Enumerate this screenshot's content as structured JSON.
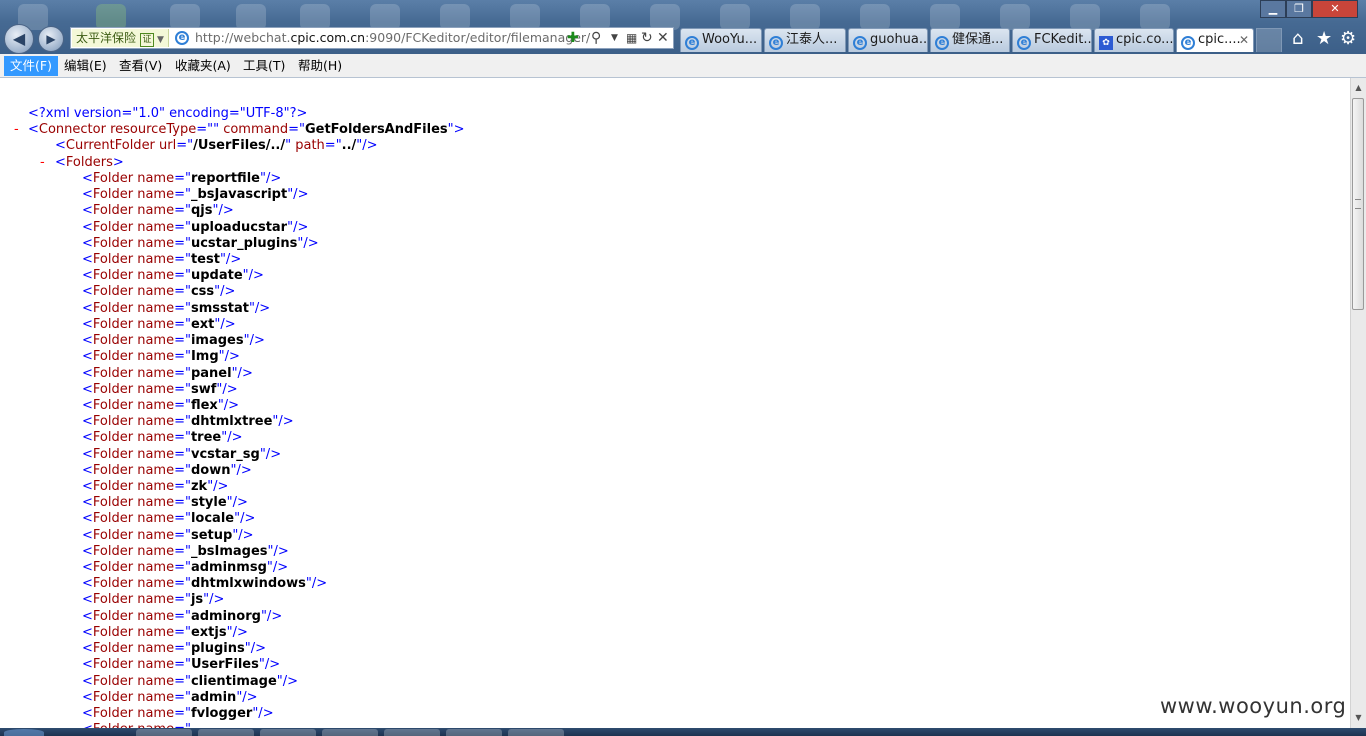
{
  "browser": {
    "site_badge": "太平洋保险",
    "site_badge_icon": "证",
    "address_host_prefix": "http://webchat.",
    "address_host_domain": "cpic.com.cn",
    "address_rest": ":9090/FCKeditor/editor/filemanager/",
    "tabs": [
      {
        "label": "WooYu...",
        "icon": "ie-icon",
        "active": false
      },
      {
        "label": "江泰人...",
        "icon": "ie-icon",
        "active": false
      },
      {
        "label": "guohua...",
        "icon": "ie-icon",
        "active": false
      },
      {
        "label": "健保通...",
        "icon": "ie-icon",
        "active": false
      },
      {
        "label": "FCKedit...",
        "icon": "ie-icon",
        "active": false
      },
      {
        "label": "cpic.co...",
        "icon": "baidu-icon",
        "active": false
      },
      {
        "label": "cpic....",
        "icon": "ie-icon",
        "active": true
      }
    ]
  },
  "menu": {
    "items": [
      "文件(F)",
      "编辑(E)",
      "查看(V)",
      "收藏夹(A)",
      "工具(T)",
      "帮助(H)"
    ]
  },
  "xml": {
    "declaration": "<?xml version=\"1.0\" encoding=\"UTF-8\"?>",
    "connector_resource_type": "",
    "connector_command": "GetFoldersAndFiles",
    "current_folder_url": "/UserFiles/../",
    "current_folder_path": "../",
    "folders": [
      "reportfile",
      "_bsJavascript",
      "qjs",
      "uploaducstar",
      "ucstar_plugins",
      "test",
      "update",
      "css",
      "smsstat",
      "ext",
      "images",
      "Img",
      "panel",
      "swf",
      "flex",
      "dhtmlxtree",
      "tree",
      "vcstar_sg",
      "down",
      "zk",
      "style",
      "locale",
      "setup",
      "_bsImages",
      "adminmsg",
      "dhtmlxwindows",
      "js",
      "adminorg",
      "extjs",
      "plugins",
      "UserFiles",
      "clientimage",
      "admin",
      "fvlogger"
    ]
  },
  "watermark": "www.wooyun.org"
}
